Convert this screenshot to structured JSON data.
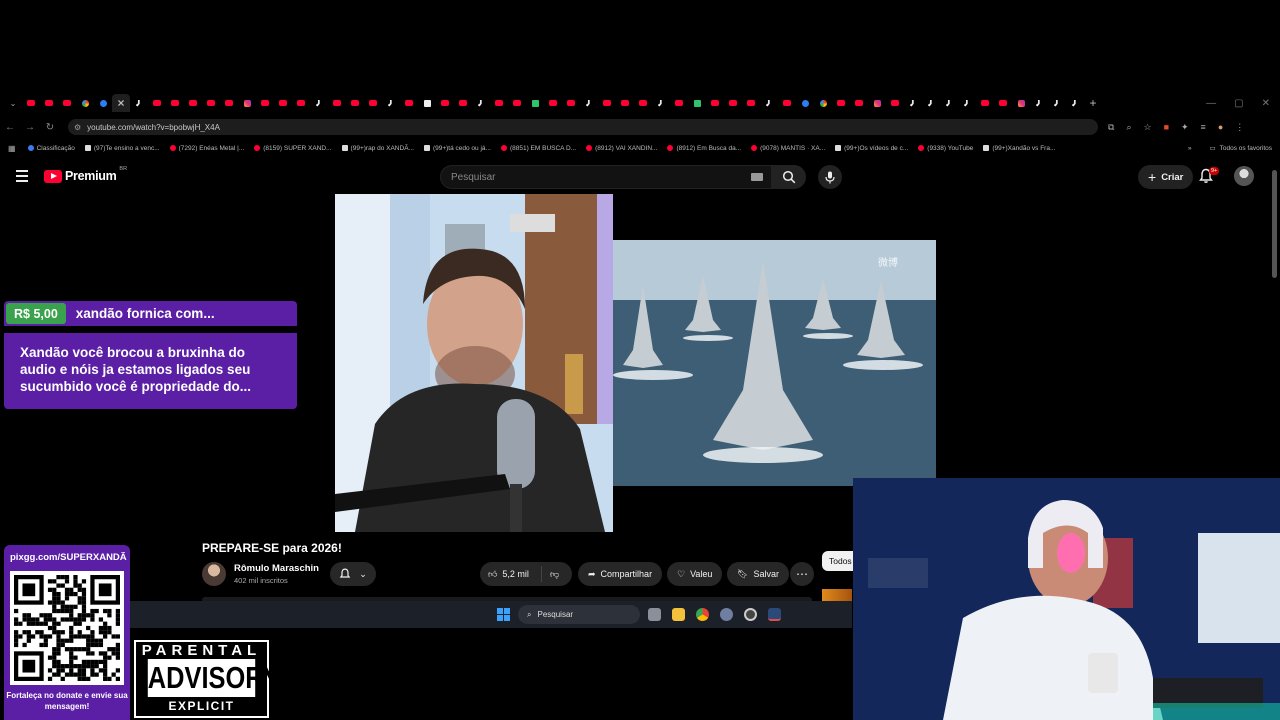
{
  "browser": {
    "url": "youtube.com/watch?v=bpobwjH_X4A",
    "tabs": [
      "yt",
      "yt",
      "yt",
      "g",
      "blue",
      "active",
      "tt",
      "yt",
      "yt",
      "yt",
      "yt",
      "yt",
      "ig",
      "yt",
      "yt",
      "yt",
      "tt",
      "yt",
      "yt",
      "yt",
      "tt",
      "yt",
      "white",
      "yt",
      "yt",
      "tt",
      "yt",
      "yt",
      "green",
      "yt",
      "yt",
      "tt",
      "yt",
      "yt",
      "yt",
      "tt",
      "yt",
      "green",
      "yt",
      "yt",
      "yt",
      "tt",
      "yt",
      "blue",
      "g",
      "yt",
      "yt",
      "ig",
      "yt",
      "tt",
      "tt",
      "tt",
      "tt",
      "yt",
      "yt",
      "ig",
      "tt",
      "tt",
      "tt"
    ],
    "new_tab_label": "+",
    "bookmarks": [
      {
        "icon": "cl",
        "label": "Classificação"
      },
      {
        "icon": "tt",
        "label": "(97)Te ensino a venc..."
      },
      {
        "icon": "yt",
        "label": "(7292) Enéas Metal |..."
      },
      {
        "icon": "yt",
        "label": "(8159) SUPER XAND..."
      },
      {
        "icon": "tt",
        "label": "(99+)rap do XANDÃ..."
      },
      {
        "icon": "tt",
        "label": "(99+)tá cedo ou já..."
      },
      {
        "icon": "yt",
        "label": "(8851) EM BUSCA D..."
      },
      {
        "icon": "yt",
        "label": "(8912) VAI XANDIN..."
      },
      {
        "icon": "yt",
        "label": "(8912) Em Busca da..."
      },
      {
        "icon": "yt",
        "label": "(9078) MANTIS · XA..."
      },
      {
        "icon": "tt",
        "label": "(99+)Os vídeos de c..."
      },
      {
        "icon": "yt",
        "label": "(9338) YouTube"
      },
      {
        "icon": "tt",
        "label": "(99+)Xandão vs Fra..."
      }
    ],
    "all_bookmarks": "Todos os favoritos"
  },
  "youtube": {
    "logo_text": "Premium",
    "logo_region": "BR",
    "search_placeholder": "Pesquisar",
    "create_label": "Criar",
    "notif_badge": "9+"
  },
  "superchat": {
    "amount": "R$ 5,00",
    "name": "xandão fornica com...",
    "message": "Xandão você brocou a bruxinha do audio e nóis ja estamos ligados seu sucumbido você é propriedade do..."
  },
  "video": {
    "title": "PREPARE-SE para 2026!",
    "channel": "Rômulo Maraschin",
    "subscribers": "402 mil inscritos",
    "likes": "5,2 mil",
    "share_label": "Compartilhar",
    "thanks_label": "Valeu",
    "save_label": "Salvar",
    "filter_chip": "Todos",
    "watermark": "微博"
  },
  "taskbar": {
    "search_label": "Pesquisar"
  },
  "overlay": {
    "pix_url": "pixgg.com/SUPERXANDÃ",
    "pix_cta": "Fortaleça no donate e envie sua mensagem!",
    "advisory_top": "PARENTAL",
    "advisory_mid": "ADVISORY",
    "advisory_bot": "EXPLICIT CONTENT"
  },
  "colors": {
    "superchat_purple": "#5b1fa5",
    "superchat_green": "#3aa24c",
    "yt_red": "#ff0033"
  }
}
